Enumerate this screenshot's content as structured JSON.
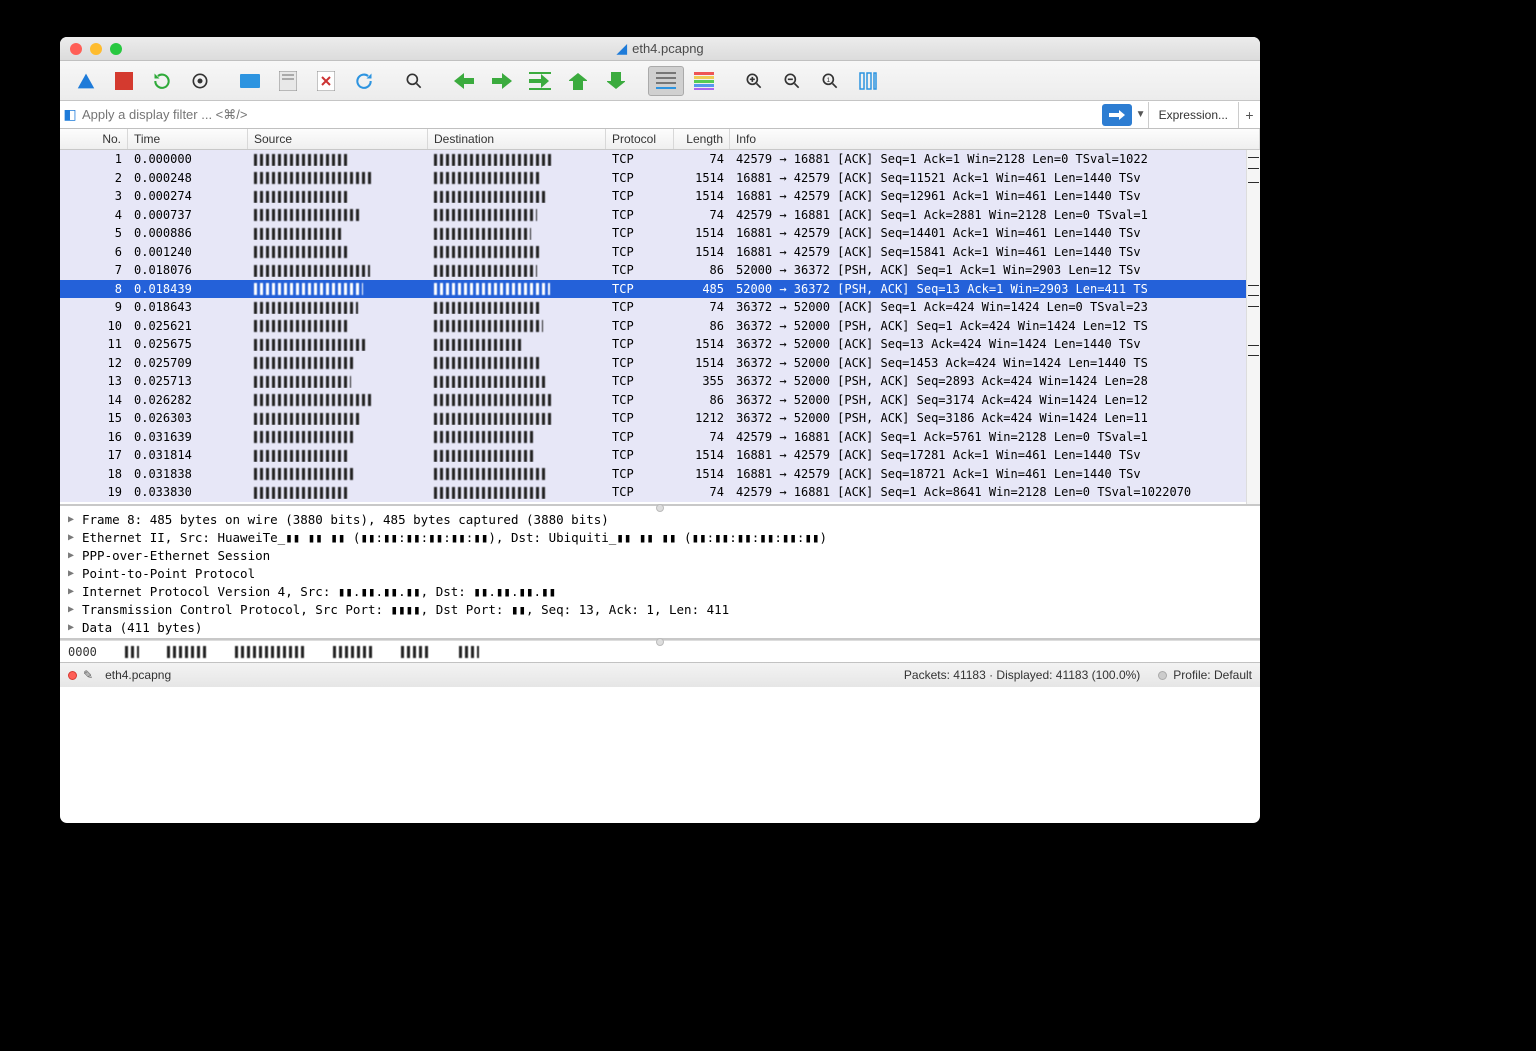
{
  "title": "eth4.pcapng",
  "filter_placeholder": "Apply a display filter ... <⌘/>",
  "expression_label": "Expression...",
  "columns": {
    "no": "No.",
    "time": "Time",
    "source": "Source",
    "destination": "Destination",
    "protocol": "Protocol",
    "length": "Length",
    "info": "Info"
  },
  "selected_index": 7,
  "packets": [
    {
      "no": 1,
      "time": "0.000000",
      "proto": "TCP",
      "len": 74,
      "info": "42579 → 16881 [ACK] Seq=1 Ack=1 Win=2128 Len=0 TSval=1022"
    },
    {
      "no": 2,
      "time": "0.000248",
      "proto": "TCP",
      "len": 1514,
      "info": "16881 → 42579 [ACK] Seq=11521 Ack=1 Win=461 Len=1440 TSv"
    },
    {
      "no": 3,
      "time": "0.000274",
      "proto": "TCP",
      "len": 1514,
      "info": "16881 → 42579 [ACK] Seq=12961 Ack=1 Win=461 Len=1440 TSv"
    },
    {
      "no": 4,
      "time": "0.000737",
      "proto": "TCP",
      "len": 74,
      "info": "42579 → 16881 [ACK] Seq=1 Ack=2881 Win=2128 Len=0 TSval=1"
    },
    {
      "no": 5,
      "time": "0.000886",
      "proto": "TCP",
      "len": 1514,
      "info": "16881 → 42579 [ACK] Seq=14401 Ack=1 Win=461 Len=1440 TSv"
    },
    {
      "no": 6,
      "time": "0.001240",
      "proto": "TCP",
      "len": 1514,
      "info": "16881 → 42579 [ACK] Seq=15841 Ack=1 Win=461 Len=1440 TSv"
    },
    {
      "no": 7,
      "time": "0.018076",
      "proto": "TCP",
      "len": 86,
      "info": "52000 → 36372 [PSH, ACK] Seq=1 Ack=1 Win=2903 Len=12 TSv"
    },
    {
      "no": 8,
      "time": "0.018439",
      "proto": "TCP",
      "len": 485,
      "info": "52000 → 36372 [PSH, ACK] Seq=13 Ack=1 Win=2903 Len=411 TS"
    },
    {
      "no": 9,
      "time": "0.018643",
      "proto": "TCP",
      "len": 74,
      "info": "36372 → 52000 [ACK] Seq=1 Ack=424 Win=1424 Len=0 TSval=23"
    },
    {
      "no": 10,
      "time": "0.025621",
      "proto": "TCP",
      "len": 86,
      "info": "36372 → 52000 [PSH, ACK] Seq=1 Ack=424 Win=1424 Len=12 TS"
    },
    {
      "no": 11,
      "time": "0.025675",
      "proto": "TCP",
      "len": 1514,
      "info": "36372 → 52000 [ACK] Seq=13 Ack=424 Win=1424 Len=1440 TSv"
    },
    {
      "no": 12,
      "time": "0.025709",
      "proto": "TCP",
      "len": 1514,
      "info": "36372 → 52000 [ACK] Seq=1453 Ack=424 Win=1424 Len=1440 TS"
    },
    {
      "no": 13,
      "time": "0.025713",
      "proto": "TCP",
      "len": 355,
      "info": "36372 → 52000 [PSH, ACK] Seq=2893 Ack=424 Win=1424 Len=28"
    },
    {
      "no": 14,
      "time": "0.026282",
      "proto": "TCP",
      "len": 86,
      "info": "36372 → 52000 [PSH, ACK] Seq=3174 Ack=424 Win=1424 Len=12"
    },
    {
      "no": 15,
      "time": "0.026303",
      "proto": "TCP",
      "len": 1212,
      "info": "36372 → 52000 [PSH, ACK] Seq=3186 Ack=424 Win=1424 Len=11"
    },
    {
      "no": 16,
      "time": "0.031639",
      "proto": "TCP",
      "len": 74,
      "info": "42579 → 16881 [ACK] Seq=1 Ack=5761 Win=2128 Len=0 TSval=1"
    },
    {
      "no": 17,
      "time": "0.031814",
      "proto": "TCP",
      "len": 1514,
      "info": "16881 → 42579 [ACK] Seq=17281 Ack=1 Win=461 Len=1440 TSv"
    },
    {
      "no": 18,
      "time": "0.031838",
      "proto": "TCP",
      "len": 1514,
      "info": "16881 → 42579 [ACK] Seq=18721 Ack=1 Win=461 Len=1440 TSv"
    },
    {
      "no": 19,
      "time": "0.033830",
      "proto": "TCP",
      "len": 74,
      "info": "42579 → 16881 [ACK] Seq=1 Ack=8641 Win=2128 Len=0 TSval=1022070"
    }
  ],
  "details": [
    "Frame 8: 485 bytes on wire (3880 bits), 485 bytes captured (3880 bits)",
    "Ethernet II, Src: HuaweiTe_▮▮ ▮▮ ▮▮ (▮▮:▮▮:▮▮:▮▮:▮▮:▮▮), Dst: Ubiquiti_▮▮ ▮▮ ▮▮ (▮▮:▮▮:▮▮:▮▮:▮▮:▮▮)",
    "PPP-over-Ethernet Session",
    "Point-to-Point Protocol",
    "Internet Protocol Version 4, Src: ▮▮.▮▮.▮▮.▮▮, Dst: ▮▮.▮▮.▮▮.▮▮",
    "Transmission Control Protocol, Src Port: ▮▮▮▮, Dst Port:  ▮▮, Seq: 13, Ack: 1, Len: 411",
    "Data (411 bytes)"
  ],
  "hex_offset": "0000",
  "status": {
    "file": "eth4.pcapng",
    "packets": "Packets: 41183 · Displayed: 41183 (100.0%)",
    "profile": "Profile: Default"
  }
}
